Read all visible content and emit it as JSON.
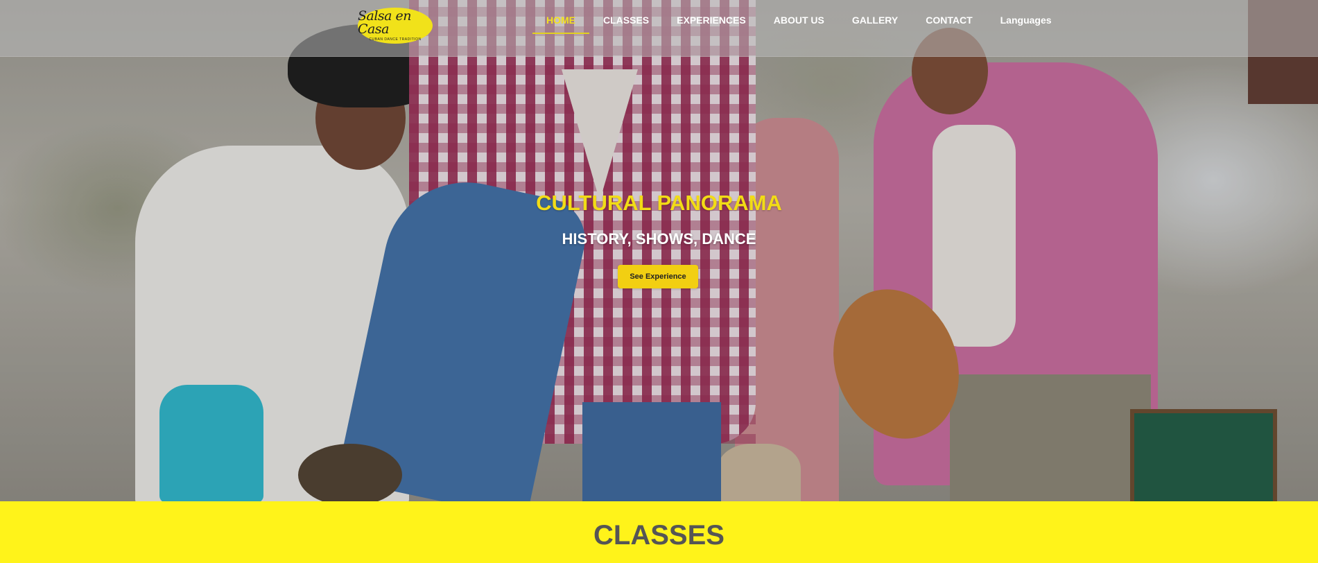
{
  "logo": {
    "script": "Salsa en Casa",
    "tagline": "CUBAN DANCE TRADITION"
  },
  "nav": {
    "items": [
      {
        "label": "HOME",
        "active": true
      },
      {
        "label": "CLASSES"
      },
      {
        "label": "EXPERIENCES"
      },
      {
        "label": "ABOUT US"
      },
      {
        "label": "GALLERY"
      },
      {
        "label": "CONTACT"
      },
      {
        "label": "Languages"
      }
    ]
  },
  "hero": {
    "title": "CULTURAL PANORAMA",
    "subtitle": "HISTORY, SHOWS, DANCE",
    "cta_label": "See Experience",
    "image": "musicians-dancers-photo"
  },
  "section": {
    "title": "CLASSES"
  },
  "colors": {
    "accent_yellow": "#f2dc16",
    "band_yellow": "#fff31a",
    "text_grey": "#555555"
  }
}
